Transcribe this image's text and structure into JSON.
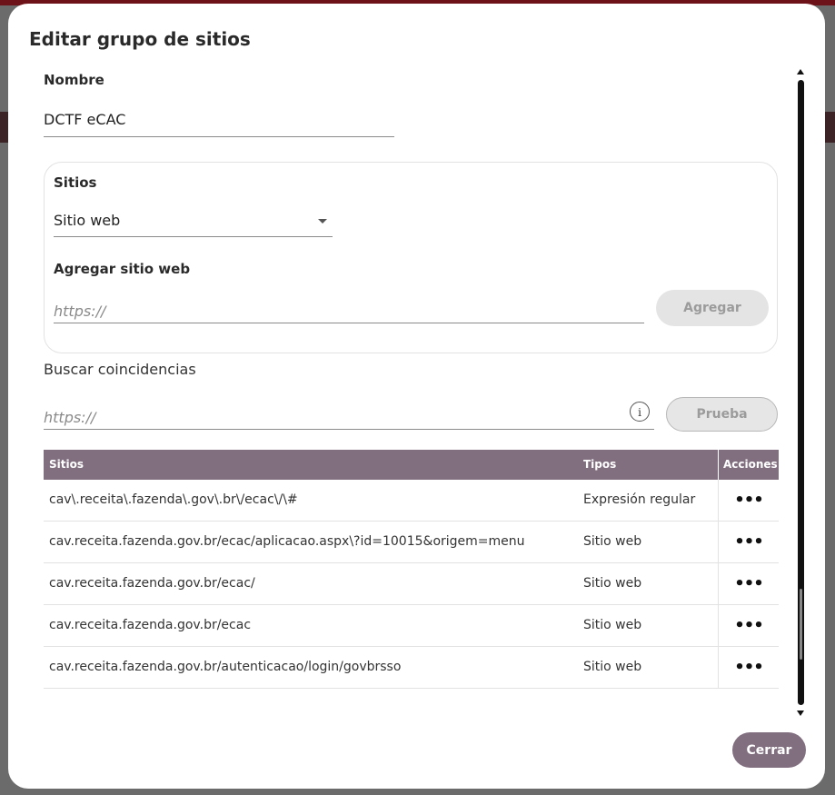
{
  "modal": {
    "title": "Editar grupo de sitios",
    "name_label": "Nombre",
    "name_value": "DCTF eCAC",
    "sites_label": "Sitios",
    "site_type_selected": "Sitio web",
    "add_site_label": "Agregar sitio web",
    "add_site_placeholder": "https://",
    "add_button": "Agregar",
    "search_label": "Buscar coincidencias",
    "search_placeholder": "https://",
    "info_icon_glyph": "i",
    "test_button": "Prueba",
    "close_button": "Cerrar"
  },
  "table": {
    "headers": {
      "sites": "Sitios",
      "types": "Tipos",
      "actions": "Acciones"
    },
    "rows": [
      {
        "site": "cav\\.receita\\.fazenda\\.gov\\.br\\/ecac\\/\\#",
        "type": "Expresión regular",
        "actions": "•••"
      },
      {
        "site": "cav.receita.fazenda.gov.br/ecac/aplicacao.aspx\\?id=10015&origem=menu",
        "type": "Sitio web",
        "actions": "•••"
      },
      {
        "site": "cav.receita.fazenda.gov.br/ecac/",
        "type": "Sitio web",
        "actions": "•••"
      },
      {
        "site": "cav.receita.fazenda.gov.br/ecac",
        "type": "Sitio web",
        "actions": "•••"
      },
      {
        "site": "cav.receita.fazenda.gov.br/autenticacao/login/govbrsso",
        "type": "Sitio web",
        "actions": "•••"
      }
    ]
  },
  "colors": {
    "accent": "#816f80",
    "disabled_button": "#e4e4e4",
    "backdrop": "#6b6b6b",
    "brand_topbar": "#6d1218"
  },
  "icons": [
    "chevron-down-icon",
    "info-icon",
    "more-actions-icon",
    "scroll-up-icon",
    "scroll-down-icon"
  ]
}
